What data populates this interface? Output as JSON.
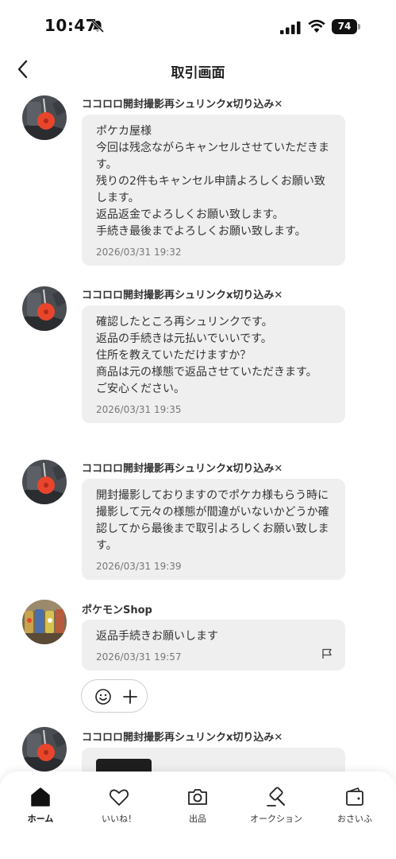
{
  "status_bar": {
    "time": "10:47",
    "battery": "74"
  },
  "header": {
    "title": "取引画面"
  },
  "messages": [
    {
      "sender": "ココロロ開封撮影再シュリンクx切り込み✕",
      "text": "ポケカ屋様\n今回は残念ながらキャンセルさせていただきます。\n残りの2件もキャンセル申請よろしくお願い致します。\n返品返金でよろしくお願い致します。\n手続き最後までよろしくお願い致します。",
      "time": "2026/03/31 19:32"
    },
    {
      "sender": "ココロロ開封撮影再シュリンクx切り込み✕",
      "text": "確認したところ再シュリンクです。\n返品の手続きは元払いでいいです。\n住所を教えていただけますか？\n商品は元の様態で返品させていただきます。\nご安心ください。",
      "time": "2026/03/31 19:35"
    },
    {
      "sender": "ココロロ開封撮影再シュリンクx切り込み✕",
      "text": "開封撮影しておりますのでポケカ様もらう時に撮影して元々の様態が間違がいないかどうか確認してから最後まで取引よろしくお願い致します。",
      "time": "2026/03/31 19:39"
    },
    {
      "sender": "ポケモンShop",
      "text": "返品手続きお願いします",
      "time": "2026/03/31 19:57"
    },
    {
      "sender": "ココロロ開封撮影再シュリンクx切り込み✕"
    }
  ],
  "tabs": [
    {
      "label": "ホーム",
      "icon": "home-icon",
      "active": true
    },
    {
      "label": "いいね！",
      "icon": "heart-icon"
    },
    {
      "label": "出品",
      "icon": "camera-icon"
    },
    {
      "label": "オークション",
      "icon": "gavel-icon"
    },
    {
      "label": "おさいふ",
      "icon": "wallet-icon"
    }
  ],
  "colors": {
    "bubble": "#efefef",
    "text": "#333333",
    "accent": "#e8452c"
  }
}
